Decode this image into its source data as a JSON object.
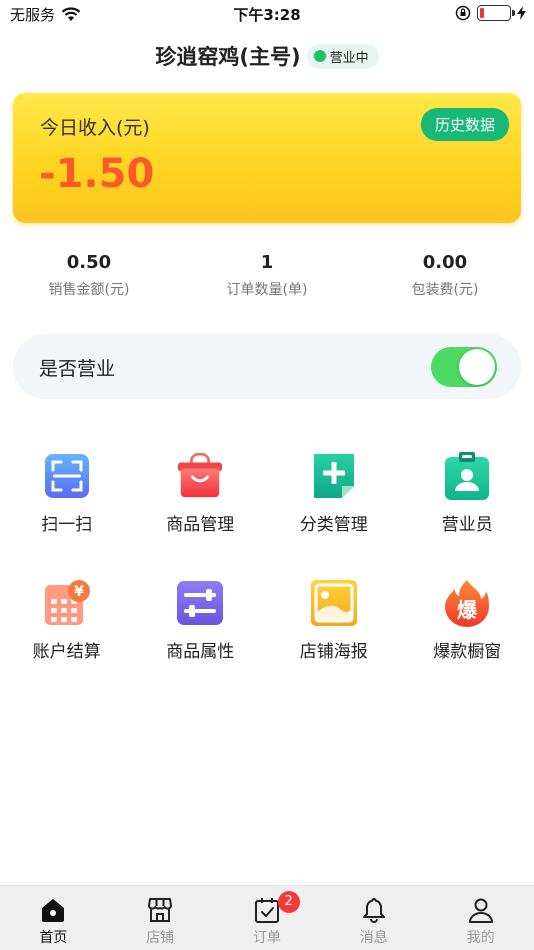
{
  "status_bar": {
    "carrier": "无服务",
    "time": "下午3:28",
    "battery_level": 0.15
  },
  "header": {
    "shop_name": "珍逍窑鸡(主号)",
    "status_badge": "营业中"
  },
  "income_card": {
    "label": "今日收入(元)",
    "value": "-1.50",
    "history_button": "历史数据"
  },
  "stats": [
    {
      "value": "0.50",
      "label": "销售金额(元)"
    },
    {
      "value": "1",
      "label": "订单数量(单)"
    },
    {
      "value": "0.00",
      "label": "包装费(元)"
    }
  ],
  "business_toggle": {
    "label": "是否营业",
    "on": true
  },
  "menu": [
    {
      "label": "扫一扫",
      "icon": "scan-icon"
    },
    {
      "label": "商品管理",
      "icon": "shopping-bag-icon"
    },
    {
      "label": "分类管理",
      "icon": "add-category-icon"
    },
    {
      "label": "营业员",
      "icon": "staff-badge-icon"
    },
    {
      "label": "账户结算",
      "icon": "calculator-yen-icon"
    },
    {
      "label": "商品属性",
      "icon": "sliders-icon"
    },
    {
      "label": "店铺海报",
      "icon": "poster-image-icon"
    },
    {
      "label": "爆款橱窗",
      "icon": "hot-flame-icon",
      "glyph": "爆"
    }
  ],
  "tabbar": [
    {
      "label": "首页",
      "icon": "home-icon",
      "active": true
    },
    {
      "label": "店铺",
      "icon": "store-icon",
      "active": false
    },
    {
      "label": "订单",
      "icon": "orders-icon",
      "active": false,
      "badge": "2"
    },
    {
      "label": "消息",
      "icon": "bell-icon",
      "active": false
    },
    {
      "label": "我的",
      "icon": "user-icon",
      "active": false
    }
  ],
  "colors": {
    "accent_green": "#17b978",
    "income_negative": "#fa5a2a",
    "toggle_on": "#4cd964",
    "badge_red": "#f23a3a"
  }
}
